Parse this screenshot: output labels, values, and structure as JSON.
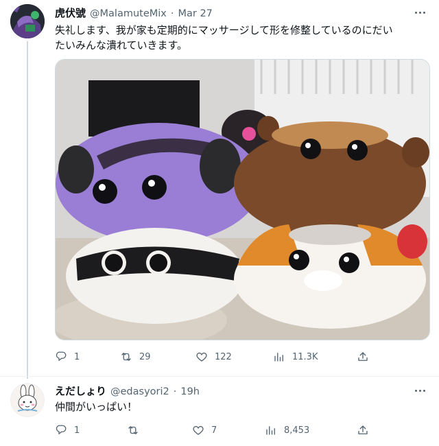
{
  "tweet1": {
    "display_name": "虎伏號",
    "handle": "@MalamuteMix",
    "separator": "·",
    "time": "Mar 27",
    "text_line1": "失礼します、我が家も定期的にマッサージして形を修整しているのにだい",
    "text_line2": "たいみんな潰れていきます。",
    "stats": {
      "replies": "1",
      "retweets": "29",
      "likes": "122",
      "views": "11.3K"
    }
  },
  "tweet2": {
    "display_name": "えだしょり",
    "handle": "@edasyori2",
    "separator": "·",
    "time": "19h",
    "text": "仲間がいっぱい！",
    "stats": {
      "replies": "1",
      "retweets": "",
      "likes": "7",
      "views": "8,453"
    }
  },
  "icons": {
    "reply": "reply-icon",
    "retweet": "retweet-icon",
    "like": "heart-icon",
    "views": "views-icon",
    "share": "share-icon",
    "more": "more-icon"
  },
  "colors": {
    "text_primary": "#0f1419",
    "text_secondary": "#536471",
    "border": "#cfd9de"
  }
}
